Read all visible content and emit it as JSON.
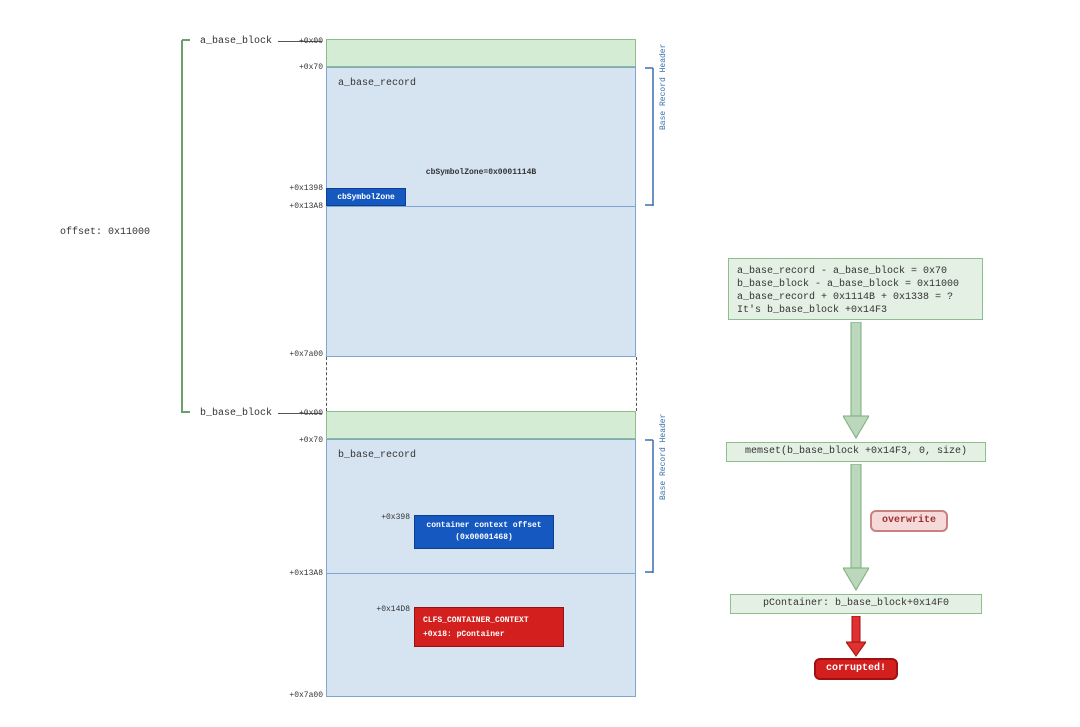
{
  "left": {
    "offset_label": "offset: 0x11000",
    "blockA": {
      "title": "a_base_block",
      "header_top_offset": "+0x00",
      "record_offset": "+0x70",
      "record_title": "a_base_record",
      "symbol_zone_text": "cbSymbolZone=0x0001114B",
      "symbol_zone_offset": "+0x1398",
      "symbol_zone_field": "cbSymbolZone",
      "end_header_offset": "+0x13A8",
      "end_block_offset": "+0x7a00",
      "brace_label": "Base Record Header"
    },
    "blockB": {
      "title": "b_base_block",
      "header_top_offset": "+0x00",
      "record_offset": "+0x70",
      "record_title": "b_base_record",
      "ctx_off_offset": "+0x398",
      "ctx_off_line1": "container context offset",
      "ctx_off_line2": "(0x00001468)",
      "end_header_offset": "+0x13A8",
      "clfs_offset": "+0x14D8",
      "clfs_line1": "CLFS_CONTAINER_CONTEXT",
      "clfs_line2": "+0x18: pContainer",
      "end_block_offset": "+0x7a00",
      "brace_label": "Base Record Header"
    }
  },
  "right": {
    "calc_lines": [
      "a_base_record - a_base_block = 0x70",
      "b_base_block - a_base_block = 0x11000",
      "a_base_record + 0x1114B + 0x1338 = ?",
      "It's b_base_block +0x14F3"
    ],
    "memset": "memset(b_base_block +0x14F3, 0, size)",
    "overwrite": "overwrite",
    "pcontainer": "pContainer: b_base_block+0x14F0",
    "corrupted": "corrupted!"
  }
}
